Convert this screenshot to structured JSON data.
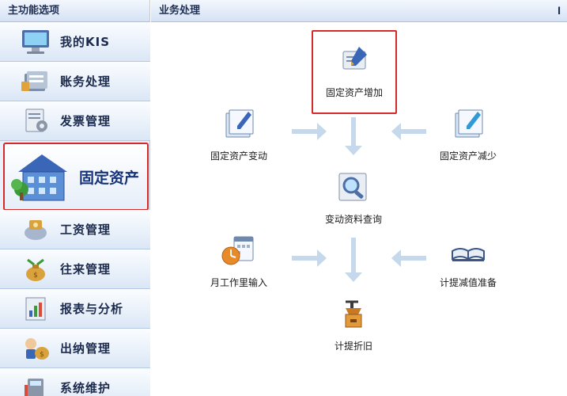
{
  "sidebar": {
    "header": "主功能选项",
    "items": [
      {
        "label": "我的KIS"
      },
      {
        "label": "账务处理"
      },
      {
        "label": "发票管理"
      },
      {
        "label": "固定资产"
      },
      {
        "label": "工资管理"
      },
      {
        "label": "往来管理"
      },
      {
        "label": "报表与分析"
      },
      {
        "label": "出纳管理"
      },
      {
        "label": "系统维护"
      }
    ]
  },
  "main": {
    "header": "业务处理",
    "corner": "l",
    "nodes": {
      "add": {
        "label": "固定资产增加"
      },
      "change": {
        "label": "固定资产变动"
      },
      "reduce": {
        "label": "固定资产减少"
      },
      "query": {
        "label": "变动资料查询"
      },
      "workload": {
        "label": "月工作里输入"
      },
      "impairment": {
        "label": "计提减值准备"
      },
      "depreciation": {
        "label": "计提折旧"
      }
    }
  },
  "colors": {
    "highlight": "#d42a2a",
    "arrow": "#c5d8ec",
    "sidebar_bg": "#e8f0fb",
    "header_text": "#1f2f55"
  }
}
